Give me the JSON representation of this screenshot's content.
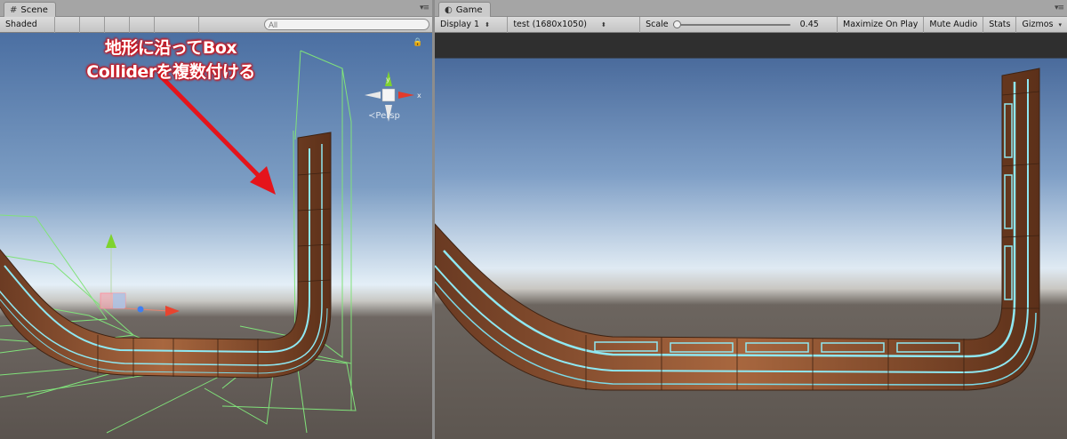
{
  "scene": {
    "tab_label": "Scene",
    "tab_glyph": "#",
    "shading_mode": "Shaded",
    "search_placeholder": "All",
    "search_icon": "search-icon",
    "persp_label": "Persp",
    "annotation_line1": "地形に沿ってBox",
    "annotation_line2": "Colliderを複数付ける",
    "annotation_color": "#e5141b",
    "gizmo_axis_x": "x",
    "collider_color": "#7ee07a"
  },
  "game": {
    "tab_label": "Game",
    "tab_icon": "game-controller-icon",
    "display": "Display 1",
    "resolution": "test (1680x1050)",
    "scale_label": "Scale",
    "scale_value": "0.45",
    "scale_fraction": 0.45,
    "maximize_on_play": "Maximize On Play",
    "mute_audio": "Mute Audio",
    "stats": "Stats",
    "gizmos": "Gizmos"
  },
  "colors": {
    "sky_top": "#4f72a3",
    "sky_horizon": "#e3eef6",
    "ground": "#5f5650",
    "track_brown": "#8a4d2c",
    "glow": "#7fe6f2"
  }
}
